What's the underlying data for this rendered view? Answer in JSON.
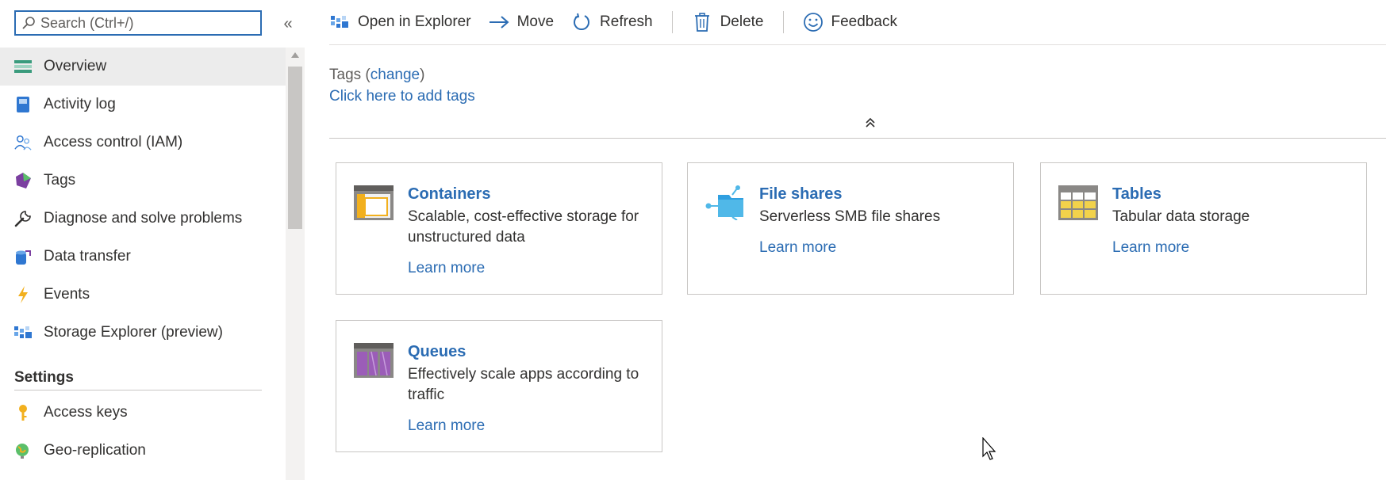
{
  "search": {
    "placeholder": "Search (Ctrl+/)"
  },
  "sidebar": {
    "collapse_label": "«",
    "items": [
      {
        "label": "Overview",
        "icon": "overview-icon"
      },
      {
        "label": "Activity log",
        "icon": "activity-log-icon"
      },
      {
        "label": "Access control (IAM)",
        "icon": "access-control-icon"
      },
      {
        "label": "Tags",
        "icon": "tags-icon"
      },
      {
        "label": "Diagnose and solve problems",
        "icon": "wrench-icon"
      },
      {
        "label": "Data transfer",
        "icon": "data-transfer-icon"
      },
      {
        "label": "Events",
        "icon": "lightning-icon"
      },
      {
        "label": "Storage Explorer (preview)",
        "icon": "storage-explorer-icon"
      }
    ],
    "settings_header": "Settings",
    "settings_items": [
      {
        "label": "Access keys",
        "icon": "key-icon"
      },
      {
        "label": "Geo-replication",
        "icon": "globe-icon"
      }
    ]
  },
  "toolbar": {
    "open_in_explorer": "Open in Explorer",
    "move": "Move",
    "refresh": "Refresh",
    "delete": "Delete",
    "feedback": "Feedback"
  },
  "tags": {
    "label": "Tags",
    "change_link": "change",
    "add_link": "Click here to add tags"
  },
  "cards": [
    {
      "title": "Containers",
      "description": "Scalable, cost-effective storage for unstructured data",
      "link": "Learn more",
      "icon": "containers-icon"
    },
    {
      "title": "File shares",
      "description": "Serverless SMB file shares",
      "link": "Learn more",
      "icon": "file-shares-icon"
    },
    {
      "title": "Tables",
      "description": "Tabular data storage",
      "link": "Learn more",
      "icon": "tables-icon"
    },
    {
      "title": "Queues",
      "description": "Effectively scale apps according to traffic",
      "link": "Learn more",
      "icon": "queues-icon"
    }
  ],
  "colors": {
    "link": "#2b6cb3",
    "active_bg": "#ececec",
    "border": "#c8c6c4"
  }
}
